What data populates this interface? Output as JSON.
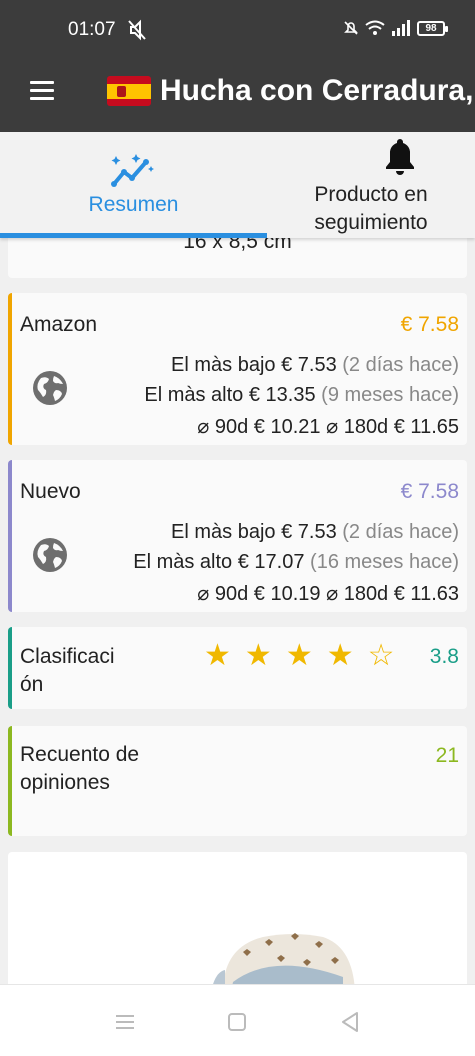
{
  "status_bar": {
    "time": "01:07",
    "battery": "98",
    "icons": [
      "mute-icon",
      "alarm-off-icon",
      "wifi-icon",
      "signal-icon",
      "battery-icon"
    ]
  },
  "app_bar": {
    "title": "Hucha con Cerradura, C",
    "flag": "spain-flag",
    "menu_icon": "hamburger-menu-icon"
  },
  "tabs": [
    {
      "label": "Resumen",
      "icon": "sparkle-chart-icon",
      "active": true
    },
    {
      "label": "Producto en seguimiento",
      "icon": "bell-icon",
      "active": false
    }
  ],
  "dimensions": {
    "text": "16 x 8,5 cm"
  },
  "price_cards": [
    {
      "name": "Amazon",
      "price": "€ 7.58",
      "accent": "#f0a500",
      "lowest_label": "El màs bajo",
      "lowest_value": "€ 7.53",
      "lowest_when": "(2 días hace)",
      "highest_label": "El màs alto",
      "highest_value": "€ 13.35",
      "highest_when": "(9 meses hace)",
      "avg_90_label": "⌀ 90d",
      "avg_90_value": "€ 10.21",
      "avg_180_label": "⌀ 180d",
      "avg_180_value": "€ 11.65"
    },
    {
      "name": "Nuevo",
      "price": "€ 7.58",
      "accent": "#8c88cc",
      "lowest_label": "El màs bajo",
      "lowest_value": "€ 7.53",
      "lowest_when": "(2 días hace)",
      "highest_label": "El màs alto",
      "highest_value": "€ 17.07",
      "highest_when": "(16 meses hace)",
      "avg_90_label": "⌀ 90d",
      "avg_90_value": "€ 10.19",
      "avg_180_label": "⌀ 180d",
      "avg_180_value": "€ 11.63"
    }
  ],
  "rating": {
    "label": "Clasificaci ón",
    "value": "3.8",
    "stars_filled": 4,
    "stars_total": 5,
    "accent": "#1a9e88"
  },
  "reviews": {
    "label": "Recuento de opiniones",
    "value": "21",
    "accent": "#8cb820"
  },
  "nav_bar": {
    "icons": [
      "recents-icon",
      "home-icon",
      "back-icon"
    ]
  }
}
